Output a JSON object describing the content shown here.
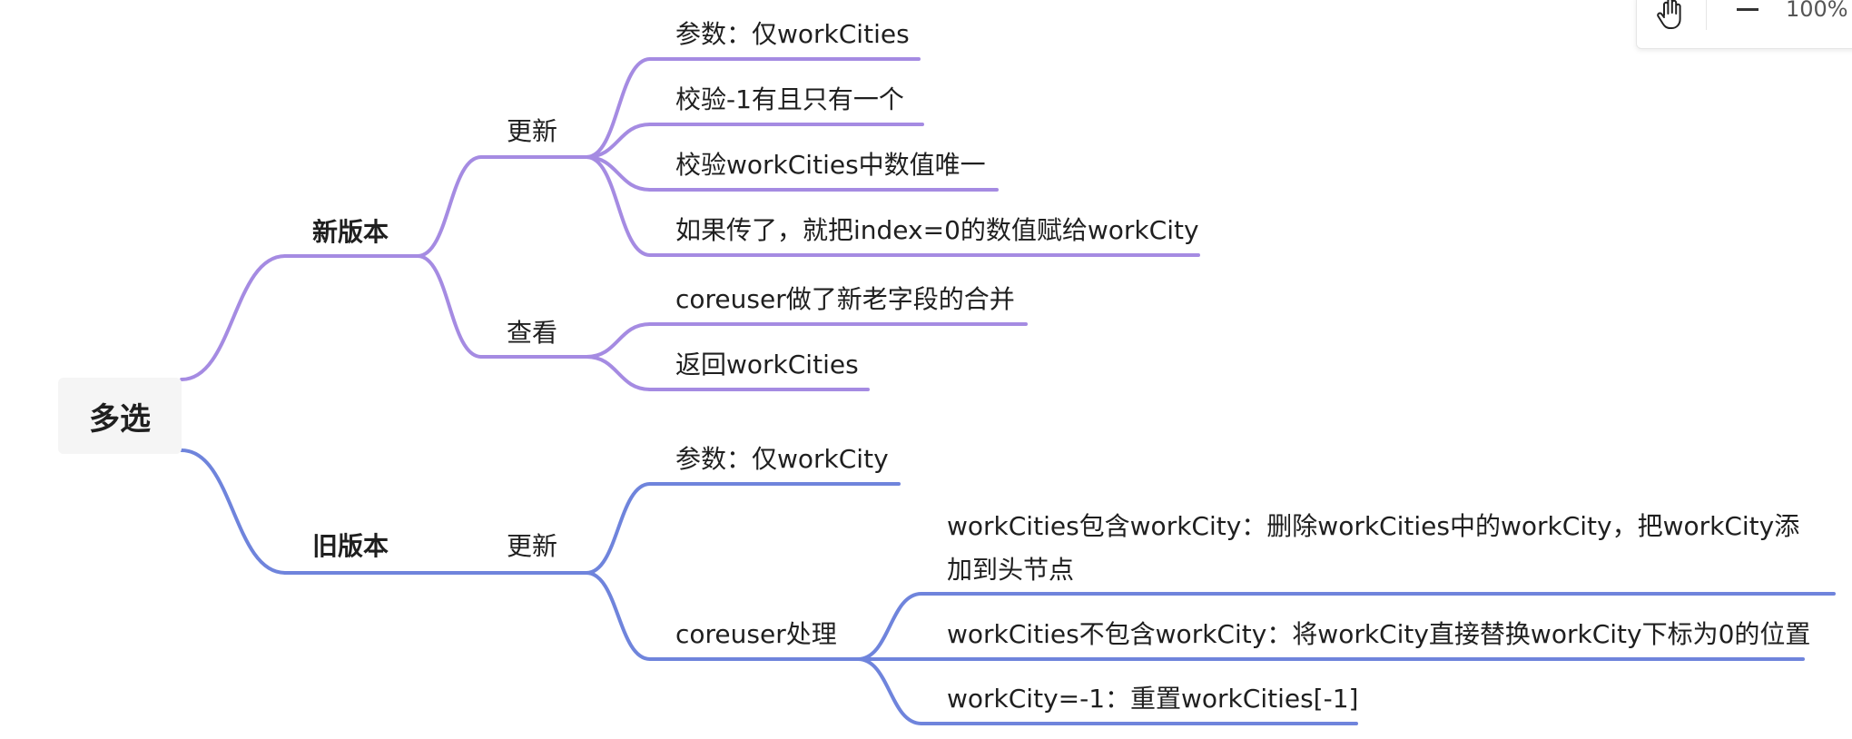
{
  "colors": {
    "purple": "#a58be2",
    "blue": "#6f84dc",
    "root_bg": "#f5f5f5"
  },
  "toolbar": {
    "pan_icon": "hand-icon",
    "zoom_out_icon": "minus-icon",
    "zoom": "100%"
  },
  "mindmap": {
    "root": "多选",
    "new_version": {
      "label": "新版本",
      "update": {
        "label": "更新",
        "items": [
          "参数：仅workCities",
          "校验-1有且只有一个",
          "校验workCities中数值唯一",
          "如果传了，就把index=0的数值赋给workCity"
        ]
      },
      "view": {
        "label": "查看",
        "items": [
          "coreuser做了新老字段的合并",
          "返回workCities"
        ]
      }
    },
    "old_version": {
      "label": "旧版本",
      "update": {
        "label": "更新",
        "param": "参数：仅workCity",
        "coreuser": {
          "label": "coreuser处理",
          "items": [
            "workCities包含workCity：删除workCities中的workCity，把workCity添加到头节点",
            "workCities不包含workCity：将workCity直接替换workCity下标为0的位置",
            "workCity=-1：重置workCities[-1]"
          ]
        }
      }
    }
  }
}
